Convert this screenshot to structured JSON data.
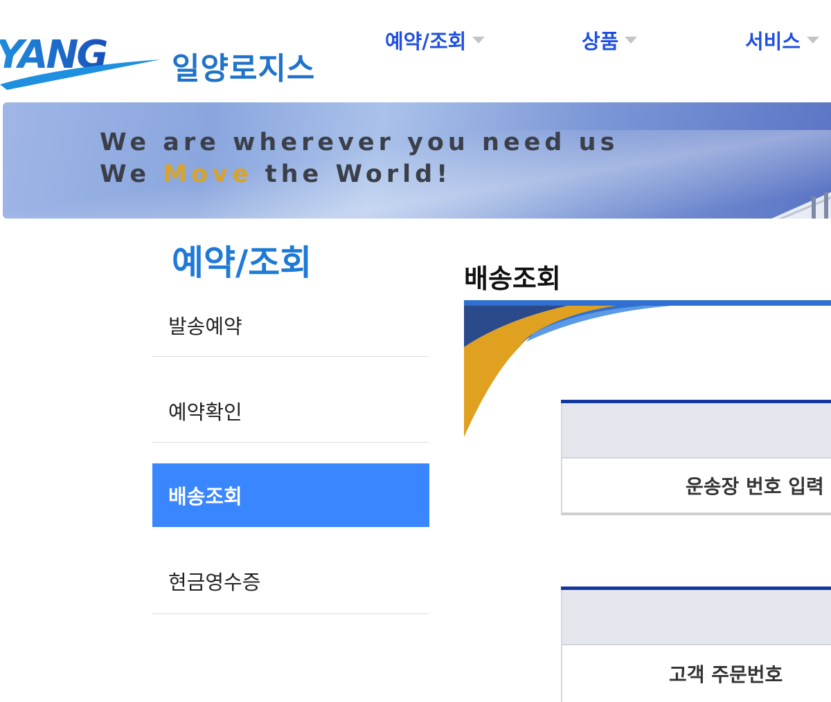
{
  "header": {
    "logo_text": "일양로지스",
    "logo_mark_text": "YANG",
    "nav": [
      {
        "label": "예약/조회"
      },
      {
        "label": "상품"
      },
      {
        "label": "서비스"
      }
    ]
  },
  "banner": {
    "line1": "We are wherever you need us",
    "line2_prefix": "We ",
    "line2_accent": "Move",
    "line2_suffix": " the World!"
  },
  "sidebar": {
    "title": "예약/조회",
    "items": [
      {
        "label": "발송예약",
        "active": false
      },
      {
        "label": "예약확인",
        "active": false
      },
      {
        "label": "배송조회",
        "active": true
      },
      {
        "label": "현금영수증",
        "active": false
      }
    ]
  },
  "main": {
    "title": "배송조회",
    "forms": [
      {
        "row_label": "운송장 번호 입력"
      },
      {
        "row_label": "고객 주문번호"
      }
    ]
  },
  "colors": {
    "brand_blue": "#1e7ad6",
    "nav_blue": "#1f4fe0",
    "active_item": "#3a86ff",
    "dark_navy": "#1537a0",
    "accent_gold": "#d9a32a"
  }
}
